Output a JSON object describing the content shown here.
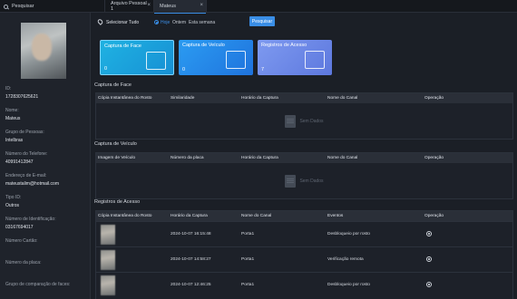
{
  "tabs": [
    {
      "label": "Pesquisar",
      "closable": false
    },
    {
      "label": "Arquivo Pessoal 1",
      "closable": true
    },
    {
      "label": "Mateus",
      "closable": true
    }
  ],
  "profile": {
    "fields": [
      {
        "label": "ID:",
        "value": "1728307625621"
      },
      {
        "label": "Nome:",
        "value": "Mateus"
      },
      {
        "label": "Grupo de Pessoas:",
        "value": "Intelbras"
      },
      {
        "label": "Número do Telefone:",
        "value": "40991412847"
      },
      {
        "label": "Endereço de E-mail:",
        "value": "mateustalim@hotmail.com"
      },
      {
        "label": "Tipo ID:",
        "value": "Outros"
      },
      {
        "label": "Número de Identificação:",
        "value": "03167694017"
      },
      {
        "label": "Número Cartão:",
        "value": ""
      },
      {
        "label": "Número da placa:",
        "value": ""
      },
      {
        "label": "Grupo de comparação de faces:",
        "value": ""
      }
    ]
  },
  "filter": {
    "select_all": "Selecionar Tudo",
    "options": [
      "Hoje",
      "Ontem",
      "Esta semana"
    ],
    "selected": "Hoje",
    "search_button": "Pesquisar"
  },
  "cards": [
    {
      "title": "Captura de Face",
      "count": "0",
      "icon": "face-scan-icon",
      "color": "#1fb2e2"
    },
    {
      "title": "Captura de Veículo",
      "count": "0",
      "icon": "vehicle-scan-icon",
      "color": "#2b9cf2"
    },
    {
      "title": "Registros de Acesso",
      "count": "7",
      "icon": "access-record-icon",
      "color": "#7e9af0"
    }
  ],
  "face_section": {
    "title": "Captura de Face",
    "columns": [
      "Cópia Instantânea do Rosto",
      "Similaridade",
      "Horário da Captura",
      "Nome do Canal",
      "Operação"
    ],
    "empty_text": "Sem Dados"
  },
  "vehicle_section": {
    "title": "Captura de Veículo",
    "columns": [
      "Imagem de Veículo",
      "Número da placa",
      "Horário da Captura",
      "Nome do Canal",
      "Operação"
    ],
    "empty_text": "Sem Dados"
  },
  "access_section": {
    "title": "Registros de Acesso",
    "columns": [
      "Cópia Instantânea do Rosto",
      "Horário da Captura",
      "Nome do Canal",
      "Eventos",
      "Operação"
    ],
    "rows": [
      {
        "time": "2024-10-07 16:15:48",
        "channel": "Porta1",
        "event": "Desbloqueio por rosto"
      },
      {
        "time": "2024-10-07 14:58:27",
        "channel": "Porta1",
        "event": "Verificação remota"
      },
      {
        "time": "2024-10-07 12:46:25",
        "channel": "Porta1",
        "event": "Desbloqueio por rosto"
      }
    ]
  },
  "colors": {
    "accent": "#3a8ee6",
    "background": "#1b1f26"
  }
}
